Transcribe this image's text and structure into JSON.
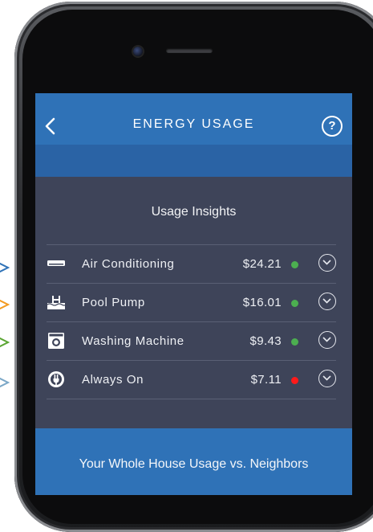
{
  "header": {
    "title": "ENERGY USAGE",
    "help_label": "?"
  },
  "insights": {
    "title": "Usage Insights",
    "items": [
      {
        "icon": "air-conditioner-icon",
        "label": "Air Conditioning",
        "amount": "$24.21",
        "status": "green"
      },
      {
        "icon": "pool-pump-icon",
        "label": "Pool Pump",
        "amount": "$16.01",
        "status": "green"
      },
      {
        "icon": "washing-machine-icon",
        "label": "Washing Machine",
        "amount": "$9.43",
        "status": "green"
      },
      {
        "icon": "power-plug-icon",
        "label": "Always On",
        "amount": "$7.11",
        "status": "red"
      }
    ]
  },
  "comparison": {
    "title": "Your Whole House Usage vs. Neighbors"
  },
  "colors": {
    "nav": "#2f72b7",
    "card": "#3e4459",
    "green": "#4caf50",
    "red": "#ff1a1a",
    "arrows": [
      "#2f72b7",
      "#f39a1e",
      "#5aa532",
      "#7aa7c7"
    ]
  }
}
